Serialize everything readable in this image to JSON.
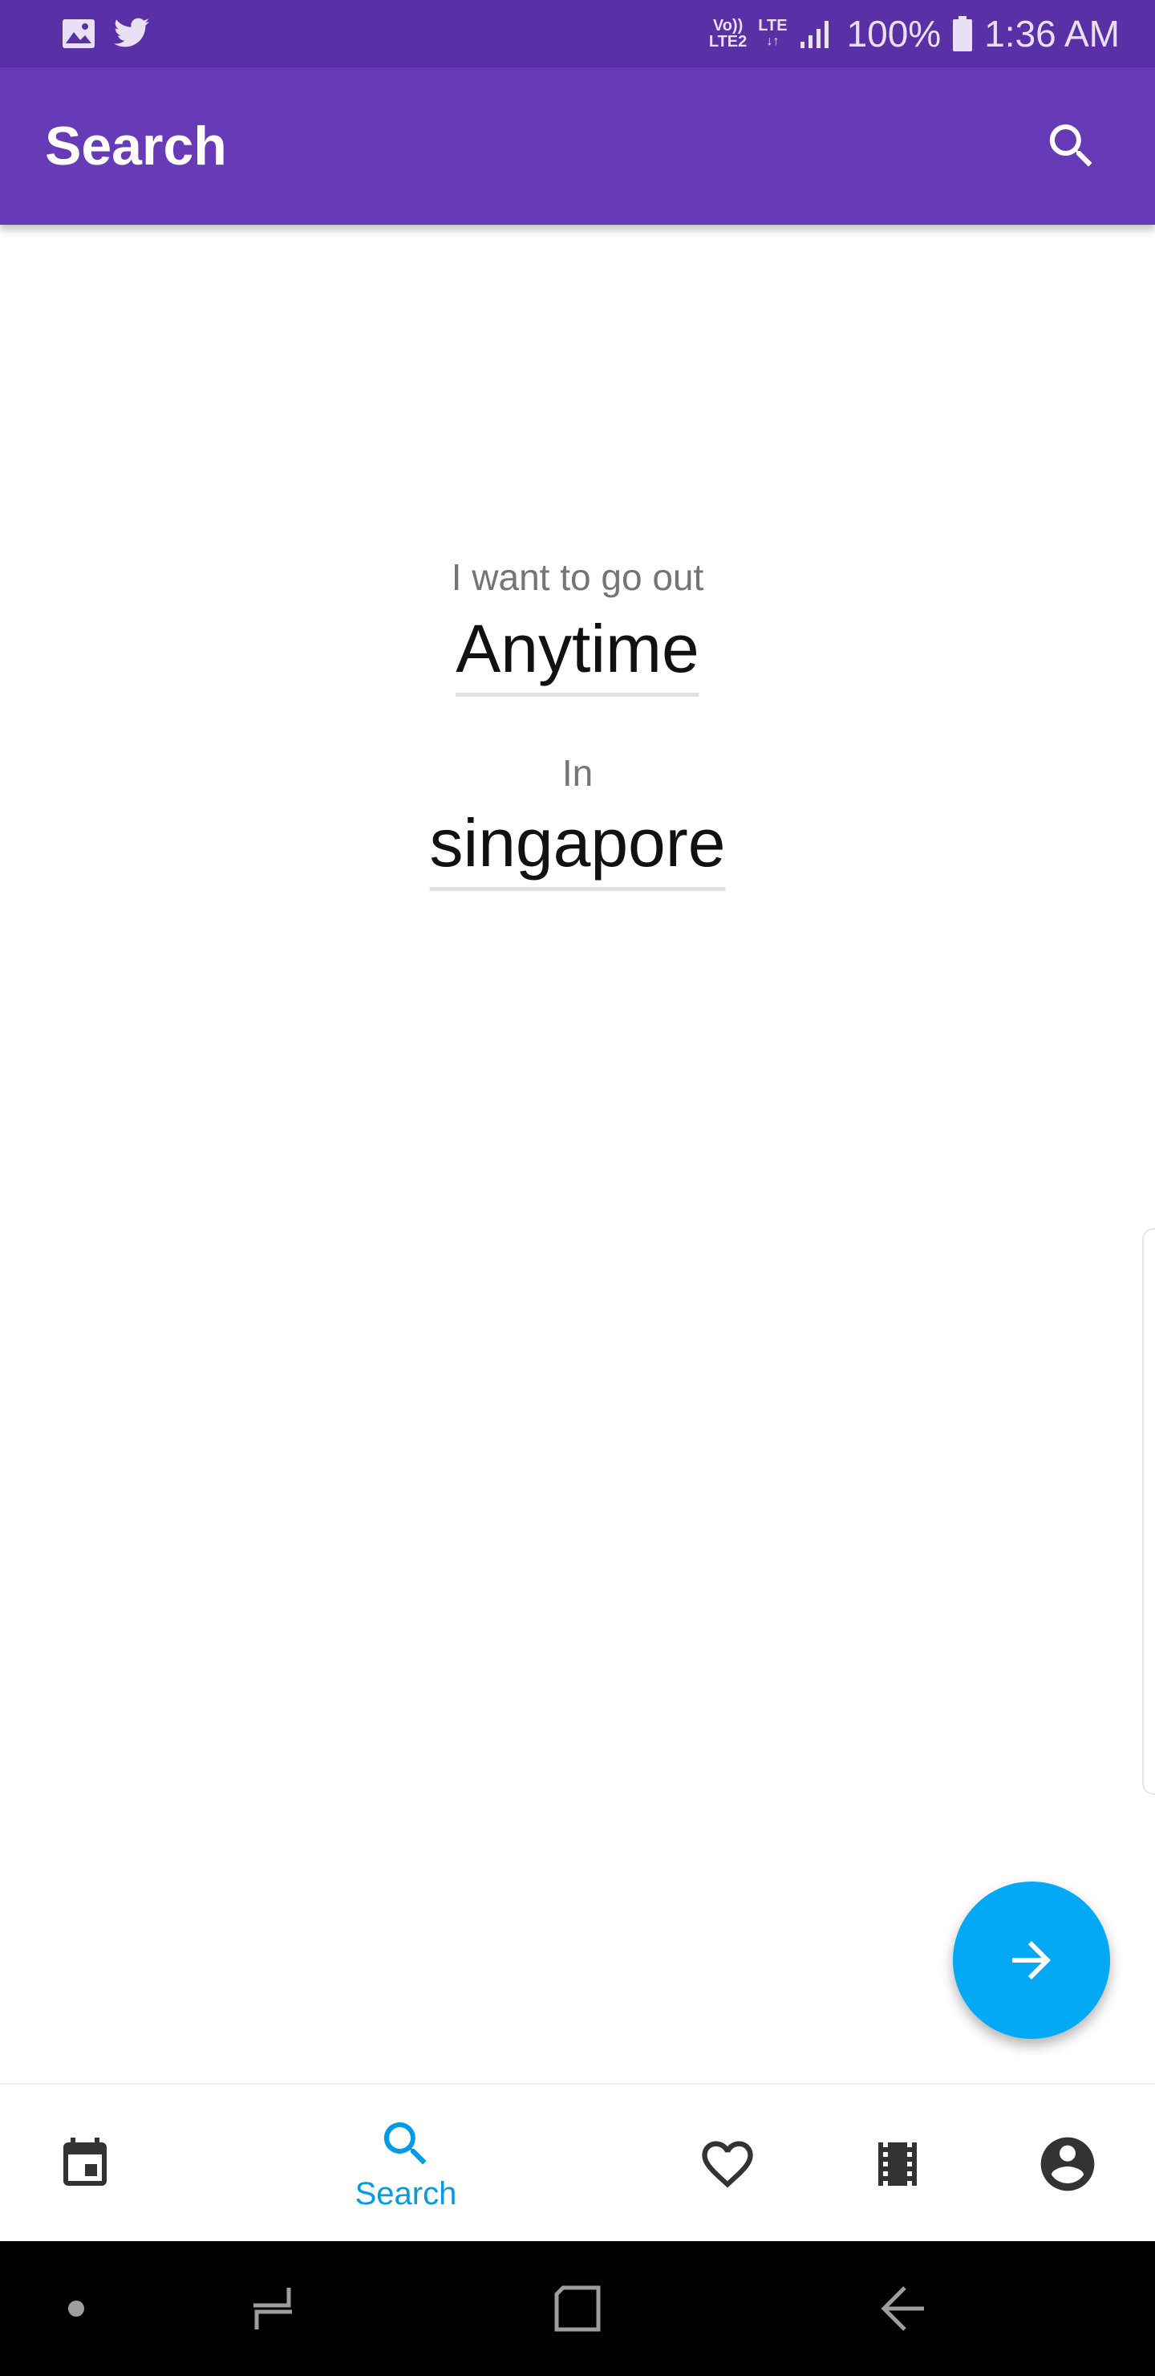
{
  "status_bar": {
    "volte_label": "Vo))",
    "lte2_label": "LTE2",
    "lte_label": "LTE",
    "battery_text": "100%",
    "time": "1:36 AM"
  },
  "app_bar": {
    "title": "Search",
    "search_icon": "search-icon"
  },
  "main": {
    "when_prompt": "I want to go out",
    "when_value": "Anytime",
    "where_prompt": "In",
    "where_value": "singapore"
  },
  "fab": {
    "icon": "arrow-forward-icon",
    "color": "#03a9f4"
  },
  "bottom_nav": {
    "items": [
      {
        "icon": "calendar-icon",
        "label": ""
      },
      {
        "icon": "search-icon",
        "label": "Search",
        "active": true
      },
      {
        "icon": "heart-icon",
        "label": ""
      },
      {
        "icon": "film-icon",
        "label": ""
      },
      {
        "icon": "account-icon",
        "label": ""
      }
    ],
    "active_color": "#039be5"
  },
  "colors": {
    "status_bar": "#5a30a6",
    "app_bar": "#673ab7",
    "accent": "#03a9f4"
  }
}
